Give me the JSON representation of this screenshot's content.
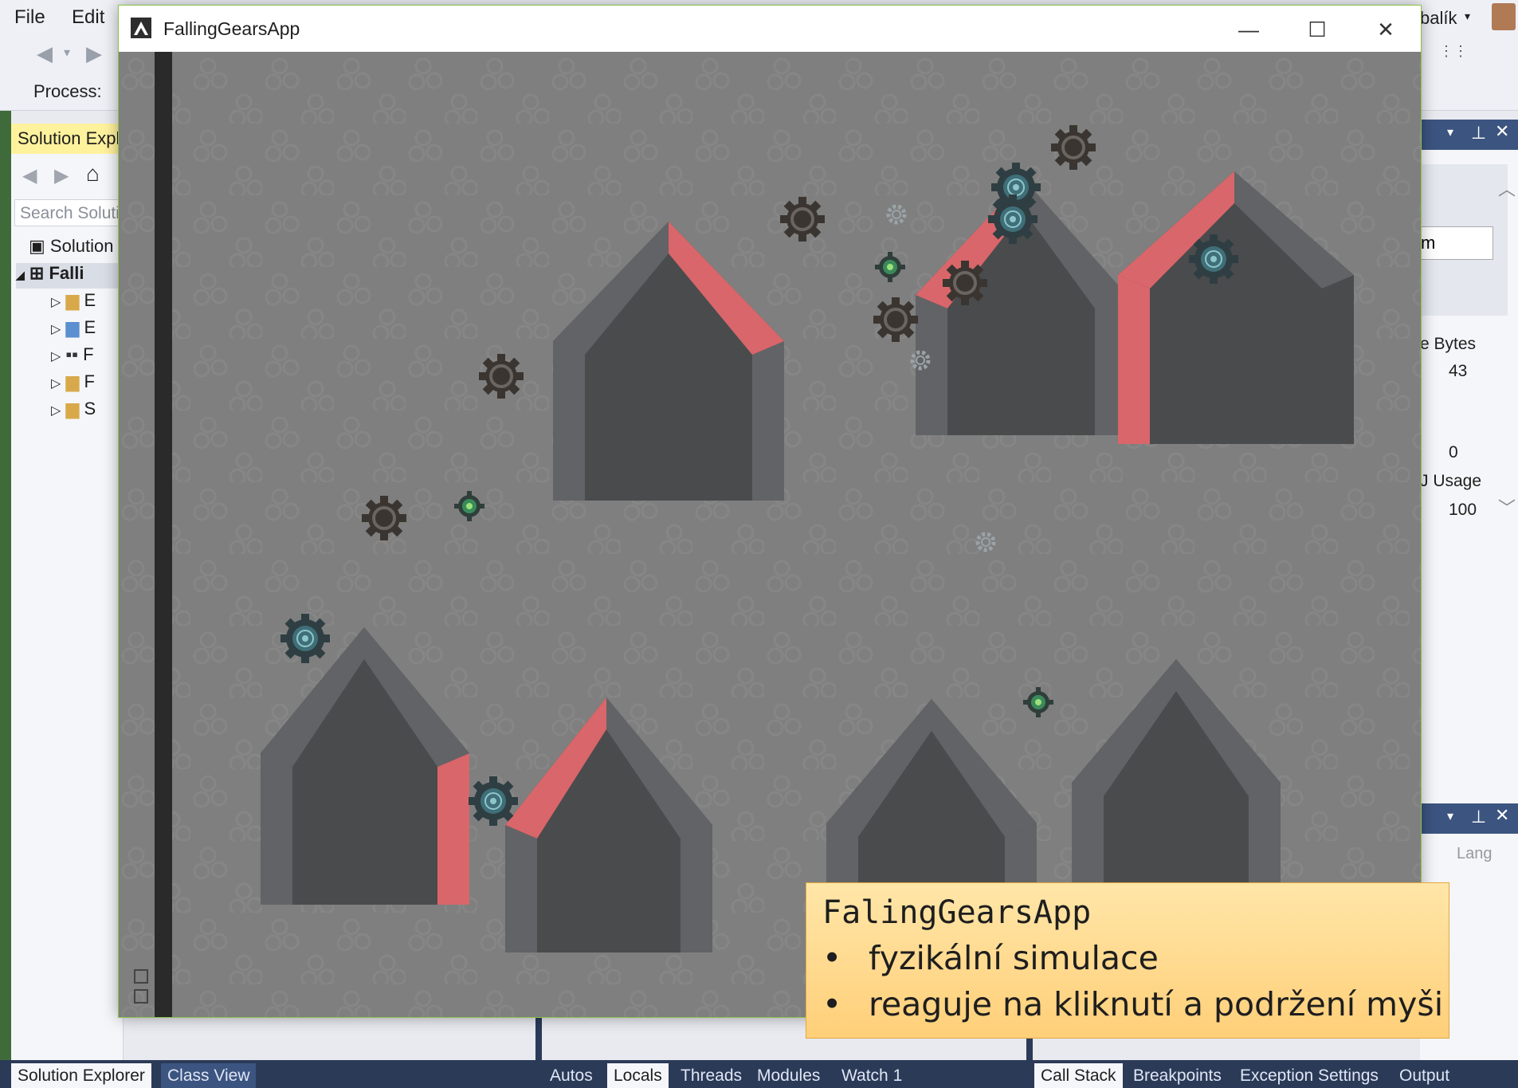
{
  "vs": {
    "menu": [
      "File",
      "Edit"
    ],
    "user": "balík",
    "process_label": "Process:",
    "solution_explorer": {
      "title": "Solution Expl",
      "search_placeholder": "Search Soluti",
      "solution_row": "Solution",
      "project_row": "Falli",
      "children": [
        "E",
        "E",
        "F",
        "F",
        "S"
      ]
    },
    "right_panel": {
      "input_text": "m",
      "col_header": "e Bytes",
      "val1": "43",
      "val2": "0",
      "usage_label": "J Usage",
      "usage_val": "100",
      "lang_label": "Lang"
    },
    "bottom_tabs_left": [
      "Solution Explorer",
      "Class View"
    ],
    "bottom_tabs_mid": [
      "Autos",
      "Locals",
      "Threads",
      "Modules",
      "Watch 1"
    ],
    "bottom_tabs_right": [
      "Call Stack",
      "Breakpoints",
      "Exception Settings",
      "Output"
    ]
  },
  "app": {
    "title": "FallingGearsApp",
    "minimize_icon": "minimize-icon",
    "maximize_icon": "maximize-icon",
    "close_icon": "close-icon"
  },
  "callout": {
    "title": "FalingGearsApp",
    "bullets": [
      "fyzikální simulace",
      "reaguje na kliknutí a podržení myši"
    ]
  },
  "colors": {
    "canvas_bg": "#7f7f7f",
    "house_body": "#4a4b4d",
    "house_bevel": "#626366",
    "accent_red": "#d9666a",
    "gear_dark": "#3a3530",
    "gear_teal": "#3f6f78",
    "gear_green": "#3b6a5a"
  }
}
